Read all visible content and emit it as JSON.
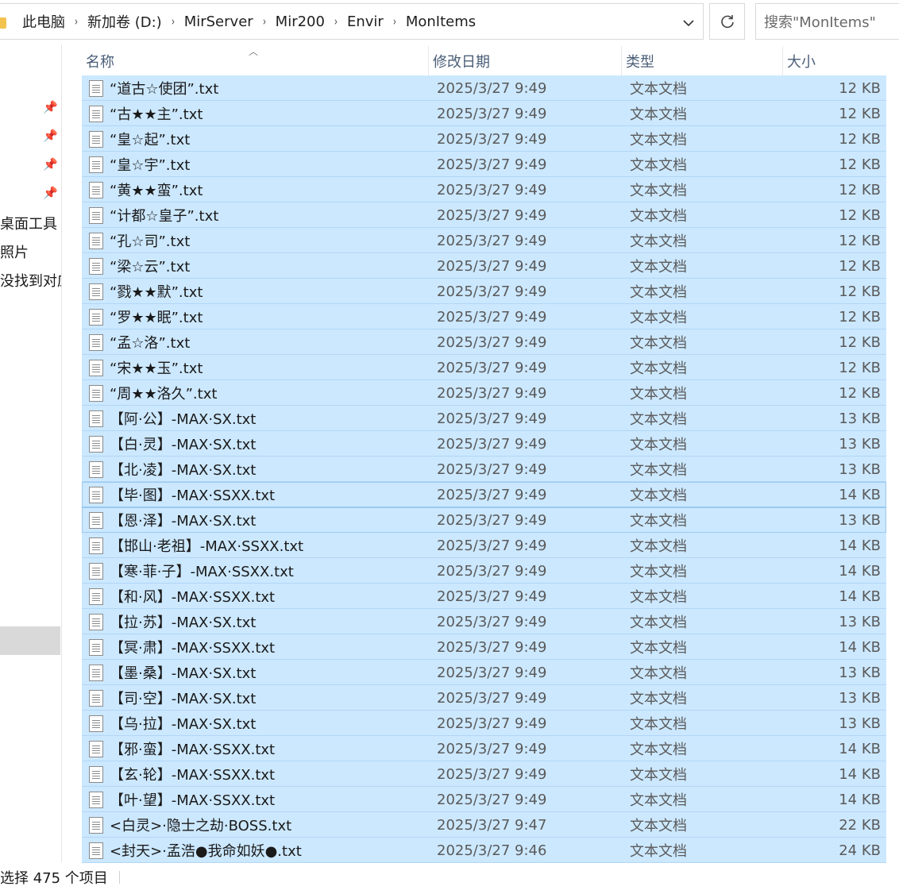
{
  "breadcrumb": {
    "items": [
      "此电脑",
      "新加卷 (D:)",
      "MirServer",
      "Mir200",
      "Envir",
      "MonItems"
    ],
    "separator": "›"
  },
  "search": {
    "placeholder": "搜索\"MonItems\""
  },
  "icons": {
    "dropdown": "chevron-down-icon",
    "refresh": "refresh-icon",
    "pin": "pin-icon",
    "file": "text-file-icon"
  },
  "nav": {
    "items": [
      "桌面工具",
      "照片",
      "没找到对应"
    ]
  },
  "columns": {
    "name": "名称",
    "date": "修改日期",
    "type": "类型",
    "size": "大小"
  },
  "files": [
    {
      "name": "“道古☆使团”.txt",
      "date": "2025/3/27 9:49",
      "type": "文本文档",
      "size": "12 KB"
    },
    {
      "name": "“古★★主”.txt",
      "date": "2025/3/27 9:49",
      "type": "文本文档",
      "size": "12 KB"
    },
    {
      "name": "“皇☆起”.txt",
      "date": "2025/3/27 9:49",
      "type": "文本文档",
      "size": "12 KB"
    },
    {
      "name": "“皇☆宇”.txt",
      "date": "2025/3/27 9:49",
      "type": "文本文档",
      "size": "12 KB"
    },
    {
      "name": "“黄★★蛮”.txt",
      "date": "2025/3/27 9:49",
      "type": "文本文档",
      "size": "12 KB"
    },
    {
      "name": "“计都☆皇子”.txt",
      "date": "2025/3/27 9:49",
      "type": "文本文档",
      "size": "12 KB"
    },
    {
      "name": "“孔☆司”.txt",
      "date": "2025/3/27 9:49",
      "type": "文本文档",
      "size": "12 KB"
    },
    {
      "name": "“梁☆云”.txt",
      "date": "2025/3/27 9:49",
      "type": "文本文档",
      "size": "12 KB"
    },
    {
      "name": "“戮★★默”.txt",
      "date": "2025/3/27 9:49",
      "type": "文本文档",
      "size": "12 KB"
    },
    {
      "name": "“罗★★眠”.txt",
      "date": "2025/3/27 9:49",
      "type": "文本文档",
      "size": "12 KB"
    },
    {
      "name": "“孟☆洛”.txt",
      "date": "2025/3/27 9:49",
      "type": "文本文档",
      "size": "12 KB"
    },
    {
      "name": "“宋★★玉”.txt",
      "date": "2025/3/27 9:49",
      "type": "文本文档",
      "size": "12 KB"
    },
    {
      "name": "“周★★洛久”.txt",
      "date": "2025/3/27 9:49",
      "type": "文本文档",
      "size": "12 KB"
    },
    {
      "name": "【阿·公】-MAX·SX.txt",
      "date": "2025/3/27 9:49",
      "type": "文本文档",
      "size": "13 KB"
    },
    {
      "name": "【白·灵】-MAX·SX.txt",
      "date": "2025/3/27 9:49",
      "type": "文本文档",
      "size": "13 KB"
    },
    {
      "name": "【北·凌】-MAX·SX.txt",
      "date": "2025/3/27 9:49",
      "type": "文本文档",
      "size": "13 KB"
    },
    {
      "name": "【毕·图】-MAX·SSXX.txt",
      "date": "2025/3/27 9:49",
      "type": "文本文档",
      "size": "14 KB"
    },
    {
      "name": "【恩·泽】-MAX·SX.txt",
      "date": "2025/3/27 9:49",
      "type": "文本文档",
      "size": "13 KB"
    },
    {
      "name": "【邯山·老祖】-MAX·SSXX.txt",
      "date": "2025/3/27 9:49",
      "type": "文本文档",
      "size": "14 KB"
    },
    {
      "name": "【寒·菲·子】-MAX·SSXX.txt",
      "date": "2025/3/27 9:49",
      "type": "文本文档",
      "size": "14 KB"
    },
    {
      "name": "【和·风】-MAX·SSXX.txt",
      "date": "2025/3/27 9:49",
      "type": "文本文档",
      "size": "14 KB"
    },
    {
      "name": "【拉·苏】-MAX·SX.txt",
      "date": "2025/3/27 9:49",
      "type": "文本文档",
      "size": "13 KB"
    },
    {
      "name": "【冥·肃】-MAX·SSXX.txt",
      "date": "2025/3/27 9:49",
      "type": "文本文档",
      "size": "14 KB"
    },
    {
      "name": "【墨·桑】-MAX·SX.txt",
      "date": "2025/3/27 9:49",
      "type": "文本文档",
      "size": "13 KB"
    },
    {
      "name": "【司·空】-MAX·SX.txt",
      "date": "2025/3/27 9:49",
      "type": "文本文档",
      "size": "13 KB"
    },
    {
      "name": "【乌·拉】-MAX·SX.txt",
      "date": "2025/3/27 9:49",
      "type": "文本文档",
      "size": "13 KB"
    },
    {
      "name": "【邪·蛮】-MAX·SSXX.txt",
      "date": "2025/3/27 9:49",
      "type": "文本文档",
      "size": "14 KB"
    },
    {
      "name": "【玄·轮】-MAX·SSXX.txt",
      "date": "2025/3/27 9:49",
      "type": "文本文档",
      "size": "14 KB"
    },
    {
      "name": "【叶·望】-MAX·SSXX.txt",
      "date": "2025/3/27 9:49",
      "type": "文本文档",
      "size": "14 KB"
    },
    {
      "name": "<白灵>·隐士之劫·BOSS.txt",
      "date": "2025/3/27 9:47",
      "type": "文本文档",
      "size": "22 KB"
    },
    {
      "name": "<封天>·孟浩●我命如妖●.txt",
      "date": "2025/3/27 9:46",
      "type": "文本文档",
      "size": "24 KB"
    }
  ],
  "status": {
    "text": "选择 475 个项目"
  },
  "colors": {
    "selection": "#cce8ff",
    "focus_border": "#99c9ef",
    "header_text": "#4a5e78"
  }
}
